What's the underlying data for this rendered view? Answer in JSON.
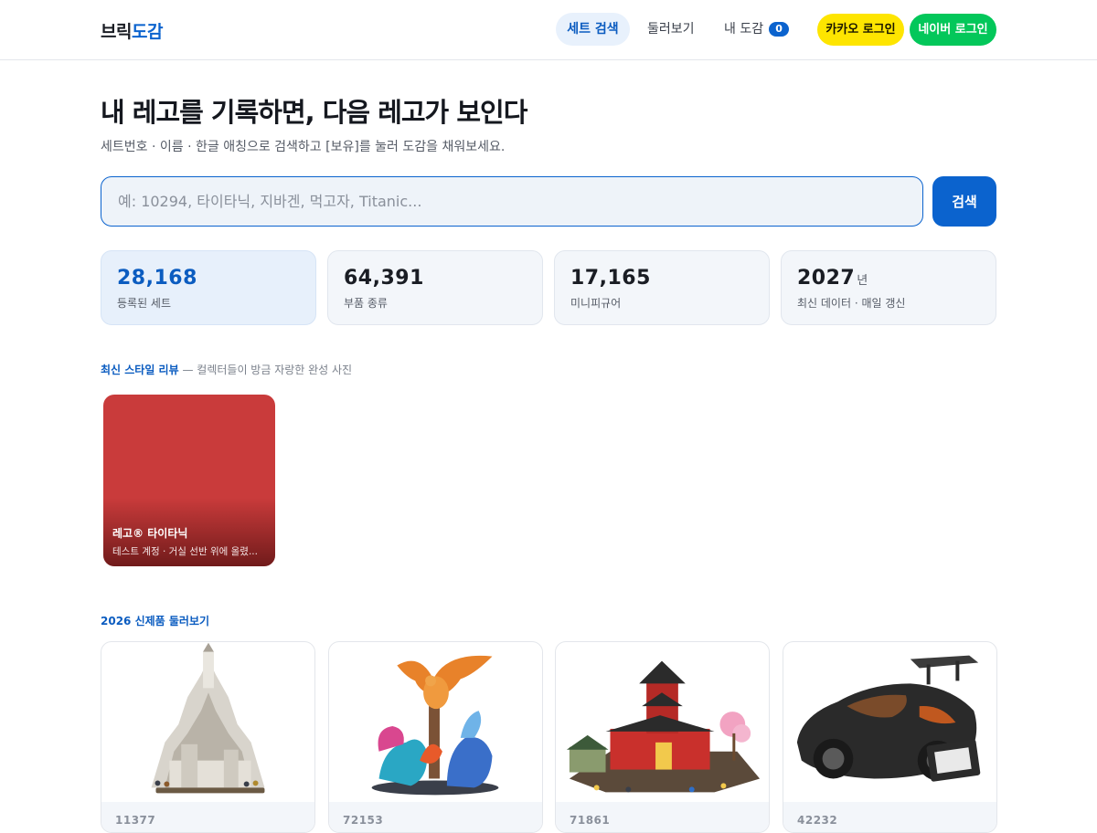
{
  "header": {
    "logo_part1": "브릭",
    "logo_part2": "도감",
    "nav": {
      "search": "세트 검색",
      "browse": "둘러보기",
      "my": "내 도감",
      "my_count": "0"
    },
    "login_kakao": "카카오 로그인",
    "login_naver": "네이버 로그인"
  },
  "hero": {
    "title": "내 레고를 기록하면, 다음 레고가 보인다",
    "subtitle": "세트번호 · 이름 · 한글 애칭으로 검색하고 [보유]를 눌러 도감을 채워보세요."
  },
  "search": {
    "placeholder": "예: 10294, 타이타닉, 지바겐, 먹고자, Titanic...",
    "button": "검색"
  },
  "stats": [
    {
      "value": "28,168",
      "unit": "",
      "label": "등록된 세트"
    },
    {
      "value": "64,391",
      "unit": "",
      "label": "부품 종류"
    },
    {
      "value": "17,165",
      "unit": "",
      "label": "미니피규어"
    },
    {
      "value": "2027",
      "unit": "년",
      "label": "최신 데이터 · 매일 갱신"
    }
  ],
  "reviews": {
    "heading_strong": "최신 스타일 리뷰",
    "heading_muted": "— 컬렉터들이 방금 자랑한 완성 사진",
    "items": [
      {
        "title": "레고® 타이타닉",
        "subtitle": "테스트 계정 · 거실 선반 위에 올렸..."
      }
    ]
  },
  "new_products": {
    "heading": "2026 신제품 둘러보기",
    "items": [
      {
        "set_no": "11377",
        "icon": "castle-set-image"
      },
      {
        "set_no": "72153",
        "icon": "dragon-set-image"
      },
      {
        "set_no": "71861",
        "icon": "temple-set-image"
      },
      {
        "set_no": "42232",
        "icon": "supercar-set-image"
      }
    ]
  },
  "colors": {
    "brand": "#0b63ce",
    "kakao": "#fee500",
    "naver": "#03c75a",
    "review_card": "#c93b3b"
  }
}
